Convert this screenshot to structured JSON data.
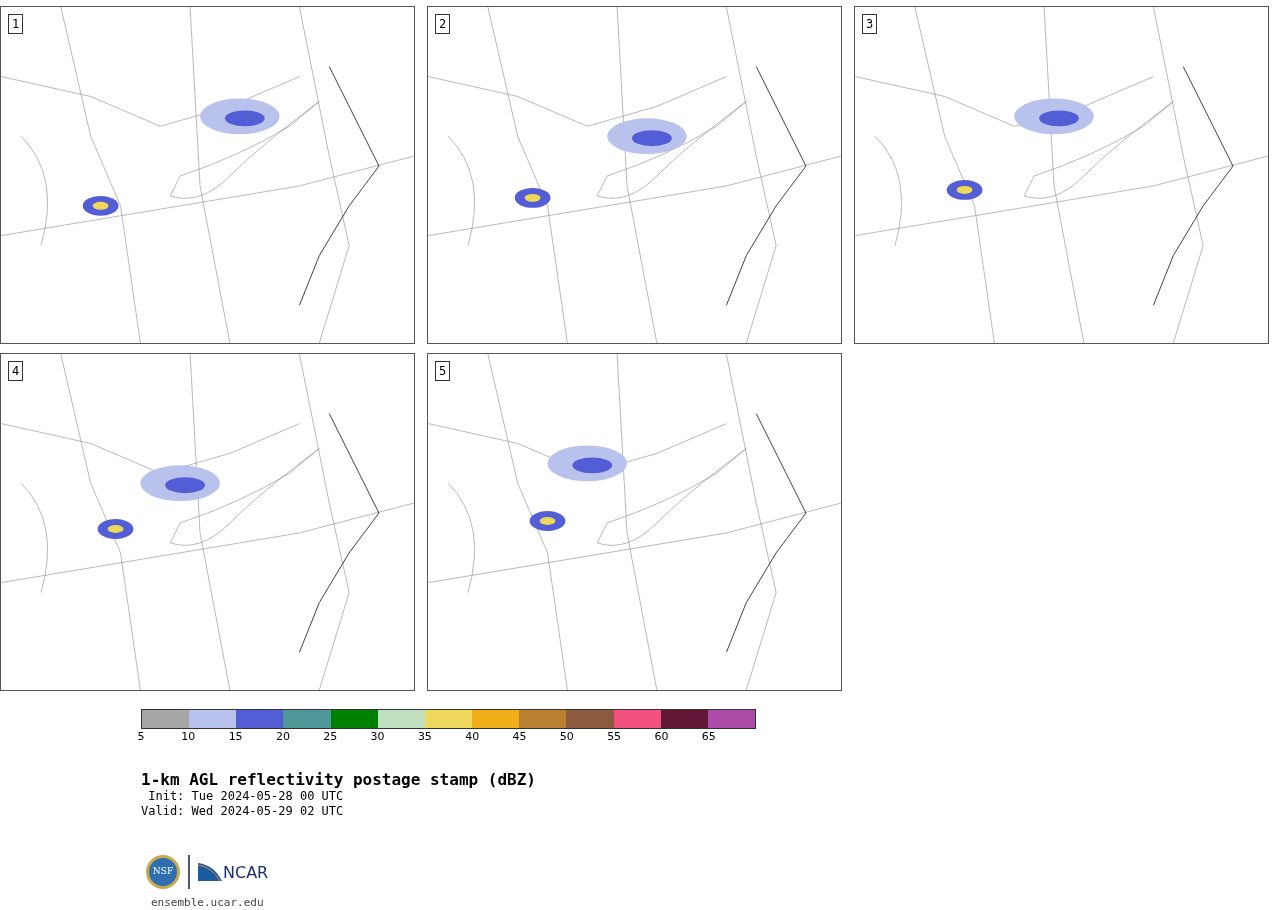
{
  "panels": [
    {
      "number": "1"
    },
    {
      "number": "2"
    },
    {
      "number": "3"
    },
    {
      "number": "4"
    },
    {
      "number": "5"
    }
  ],
  "colorbar": {
    "bins": [
      {
        "color": "#a6a6a6",
        "label": "5"
      },
      {
        "color": "#b8c2ec",
        "label": "10"
      },
      {
        "color": "#525dd6",
        "label": "15"
      },
      {
        "color": "#4e979b",
        "label": "20"
      },
      {
        "color": "#008000",
        "label": "25"
      },
      {
        "color": "#bfdfbf",
        "label": "30"
      },
      {
        "color": "#eed85b",
        "label": "35"
      },
      {
        "color": "#eeae18",
        "label": "40"
      },
      {
        "color": "#b98130",
        "label": "45"
      },
      {
        "color": "#8b5a3f",
        "label": "50"
      },
      {
        "color": "#f3517e",
        "label": "55"
      },
      {
        "color": "#621836",
        "label": "60"
      },
      {
        "color": "#ad4ca8",
        "label": "65"
      }
    ]
  },
  "title": "1-km AGL reflectivity postage stamp (dBZ)",
  "init": " Init: Tue 2024-05-28 00 UTC",
  "valid": "Valid: Wed 2024-05-29 02 UTC",
  "logos": {
    "nsf": "NSF",
    "ncar": "NCAR"
  },
  "url": "ensemble.ucar.edu"
}
